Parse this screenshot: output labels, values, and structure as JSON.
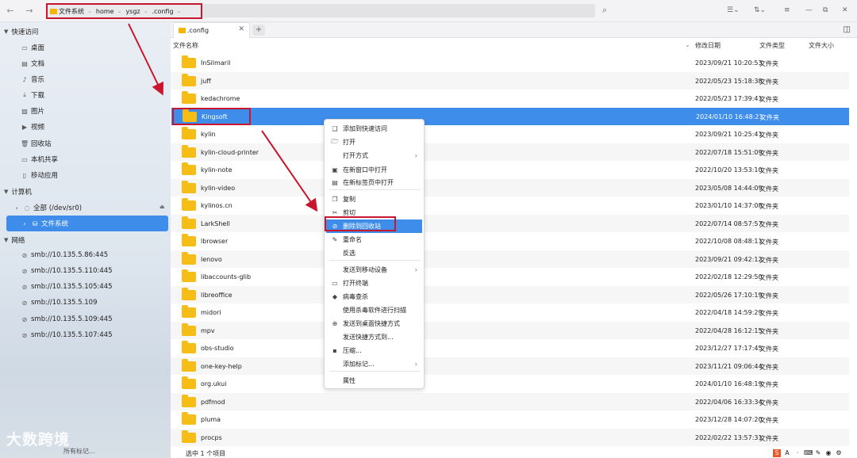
{
  "toolbar": {
    "back_icon": "arrow-left-icon",
    "forward_icon": "arrow-right-icon",
    "breadcrumbs": [
      "文件系统",
      "home",
      "ysgz",
      ".config"
    ],
    "search_icon": "search-icon"
  },
  "sidebar": {
    "quick_access": {
      "label": "快速访问",
      "items": [
        "桌面",
        "文档",
        "音乐",
        "下载",
        "图片",
        "视频",
        "回收站",
        "本机共享",
        "移动应用"
      ]
    },
    "computer": {
      "label": "计算机",
      "items": [
        "全部 (/dev/sr0)",
        "文件系统"
      ]
    },
    "network": {
      "label": "网络",
      "items": [
        "smb://10.135.5.86:445",
        "smb://10.135.5.110:445",
        "smb://10.135.5.105:445",
        "smb://10.135.5.109",
        "smb://10.135.5.109:445",
        "smb://10.135.5.107:445"
      ]
    },
    "watermark": "大数跨境",
    "bottom_text": "所有标记..."
  },
  "tabs": [
    {
      "label": ".config"
    }
  ],
  "columns": {
    "name": "文件名称",
    "date": "修改日期",
    "type": "文件类型",
    "size": "文件大小"
  },
  "files": [
    {
      "name": "InSilmaril",
      "date": "2023/09/21 10:20:53",
      "type": "文件夹"
    },
    {
      "name": "juff",
      "date": "2022/05/23 15:18:38",
      "type": "文件夹"
    },
    {
      "name": "kedachrome",
      "date": "2022/05/23 17:39:41",
      "type": "文件夹"
    },
    {
      "name": "Kingsoft",
      "date": "2024/01/10 16:48:21",
      "type": "文件夹"
    },
    {
      "name": "kylin",
      "date": "2023/09/21 10:25:41",
      "type": "文件夹"
    },
    {
      "name": "kylin-cloud-printer",
      "date": "2022/07/18 15:51:09",
      "type": "文件夹"
    },
    {
      "name": "kylin-note",
      "date": "2022/10/20 13:53:10",
      "type": "文件夹"
    },
    {
      "name": "kylin-video",
      "date": "2023/05/08 14:44:09",
      "type": "文件夹"
    },
    {
      "name": "kylinos.cn",
      "date": "2023/01/10 14:37:08",
      "type": "文件夹"
    },
    {
      "name": "LarkShell",
      "date": "2022/07/14 08:57:57",
      "type": "文件夹"
    },
    {
      "name": "lbrowser",
      "date": "2022/10/08 08:48:11",
      "type": "文件夹"
    },
    {
      "name": "lenovo",
      "date": "2023/09/21 09:42:12",
      "type": "文件夹"
    },
    {
      "name": "libaccounts-glib",
      "date": "2022/02/18 12:29:50",
      "type": "文件夹"
    },
    {
      "name": "libreoffice",
      "date": "2022/05/26 17:10:19",
      "type": "文件夹"
    },
    {
      "name": "midori",
      "date": "2022/04/18 14:59:29",
      "type": "文件夹"
    },
    {
      "name": "mpv",
      "date": "2022/04/28 16:12:15",
      "type": "文件夹"
    },
    {
      "name": "obs-studio",
      "date": "2023/12/27 17:17:45",
      "type": "文件夹"
    },
    {
      "name": "one-key-help",
      "date": "2023/11/21 09:06:44",
      "type": "文件夹"
    },
    {
      "name": "org.ukui",
      "date": "2024/01/10 16:48:19",
      "type": "文件夹"
    },
    {
      "name": "pdfmod",
      "date": "2022/04/06 16:33:34",
      "type": "文件夹"
    },
    {
      "name": "pluma",
      "date": "2023/12/28 14:07:20",
      "type": "文件夹"
    },
    {
      "name": "procps",
      "date": "2022/02/22 13:57:31",
      "type": "文件夹"
    }
  ],
  "selected_file": "Kingsoft",
  "context_menu": [
    {
      "label": "添加到快速访问",
      "icon": "bookmark-icon"
    },
    {
      "label": "打开",
      "icon": "folder-open-icon"
    },
    {
      "label": "打开方式",
      "icon": "",
      "submenu": true
    },
    {
      "label": "在新窗口中打开",
      "icon": "window-icon"
    },
    {
      "label": "在新标签页中打开",
      "icon": "tab-icon"
    },
    {
      "label": "复制",
      "icon": "copy-icon"
    },
    {
      "label": "剪切",
      "icon": "scissors-icon"
    },
    {
      "label": "删除到回收站",
      "icon": "trash-icon",
      "active": true
    },
    {
      "label": "重命名",
      "icon": "rename-icon"
    },
    {
      "label": "反选",
      "icon": ""
    },
    {
      "label": "发送到移动设备",
      "icon": "",
      "submenu": true
    },
    {
      "label": "打开终端",
      "icon": "terminal-icon"
    },
    {
      "label": "病毒查杀",
      "icon": "shield-icon"
    },
    {
      "label": "使用杀毒软件进行扫描",
      "icon": ""
    },
    {
      "label": "发送到桌面快捷方式",
      "icon": "link-icon"
    },
    {
      "label": "发送快捷方式到...",
      "icon": ""
    },
    {
      "label": "压缩...",
      "icon": "archive-icon"
    },
    {
      "label": "添加标记...",
      "icon": "",
      "submenu": true
    },
    {
      "label": "属性",
      "icon": ""
    }
  ],
  "status": "选中 1 个项目",
  "colors": {
    "accent": "#3e8dea",
    "highlight": "#c7162d",
    "folder": "#f6bd16"
  }
}
